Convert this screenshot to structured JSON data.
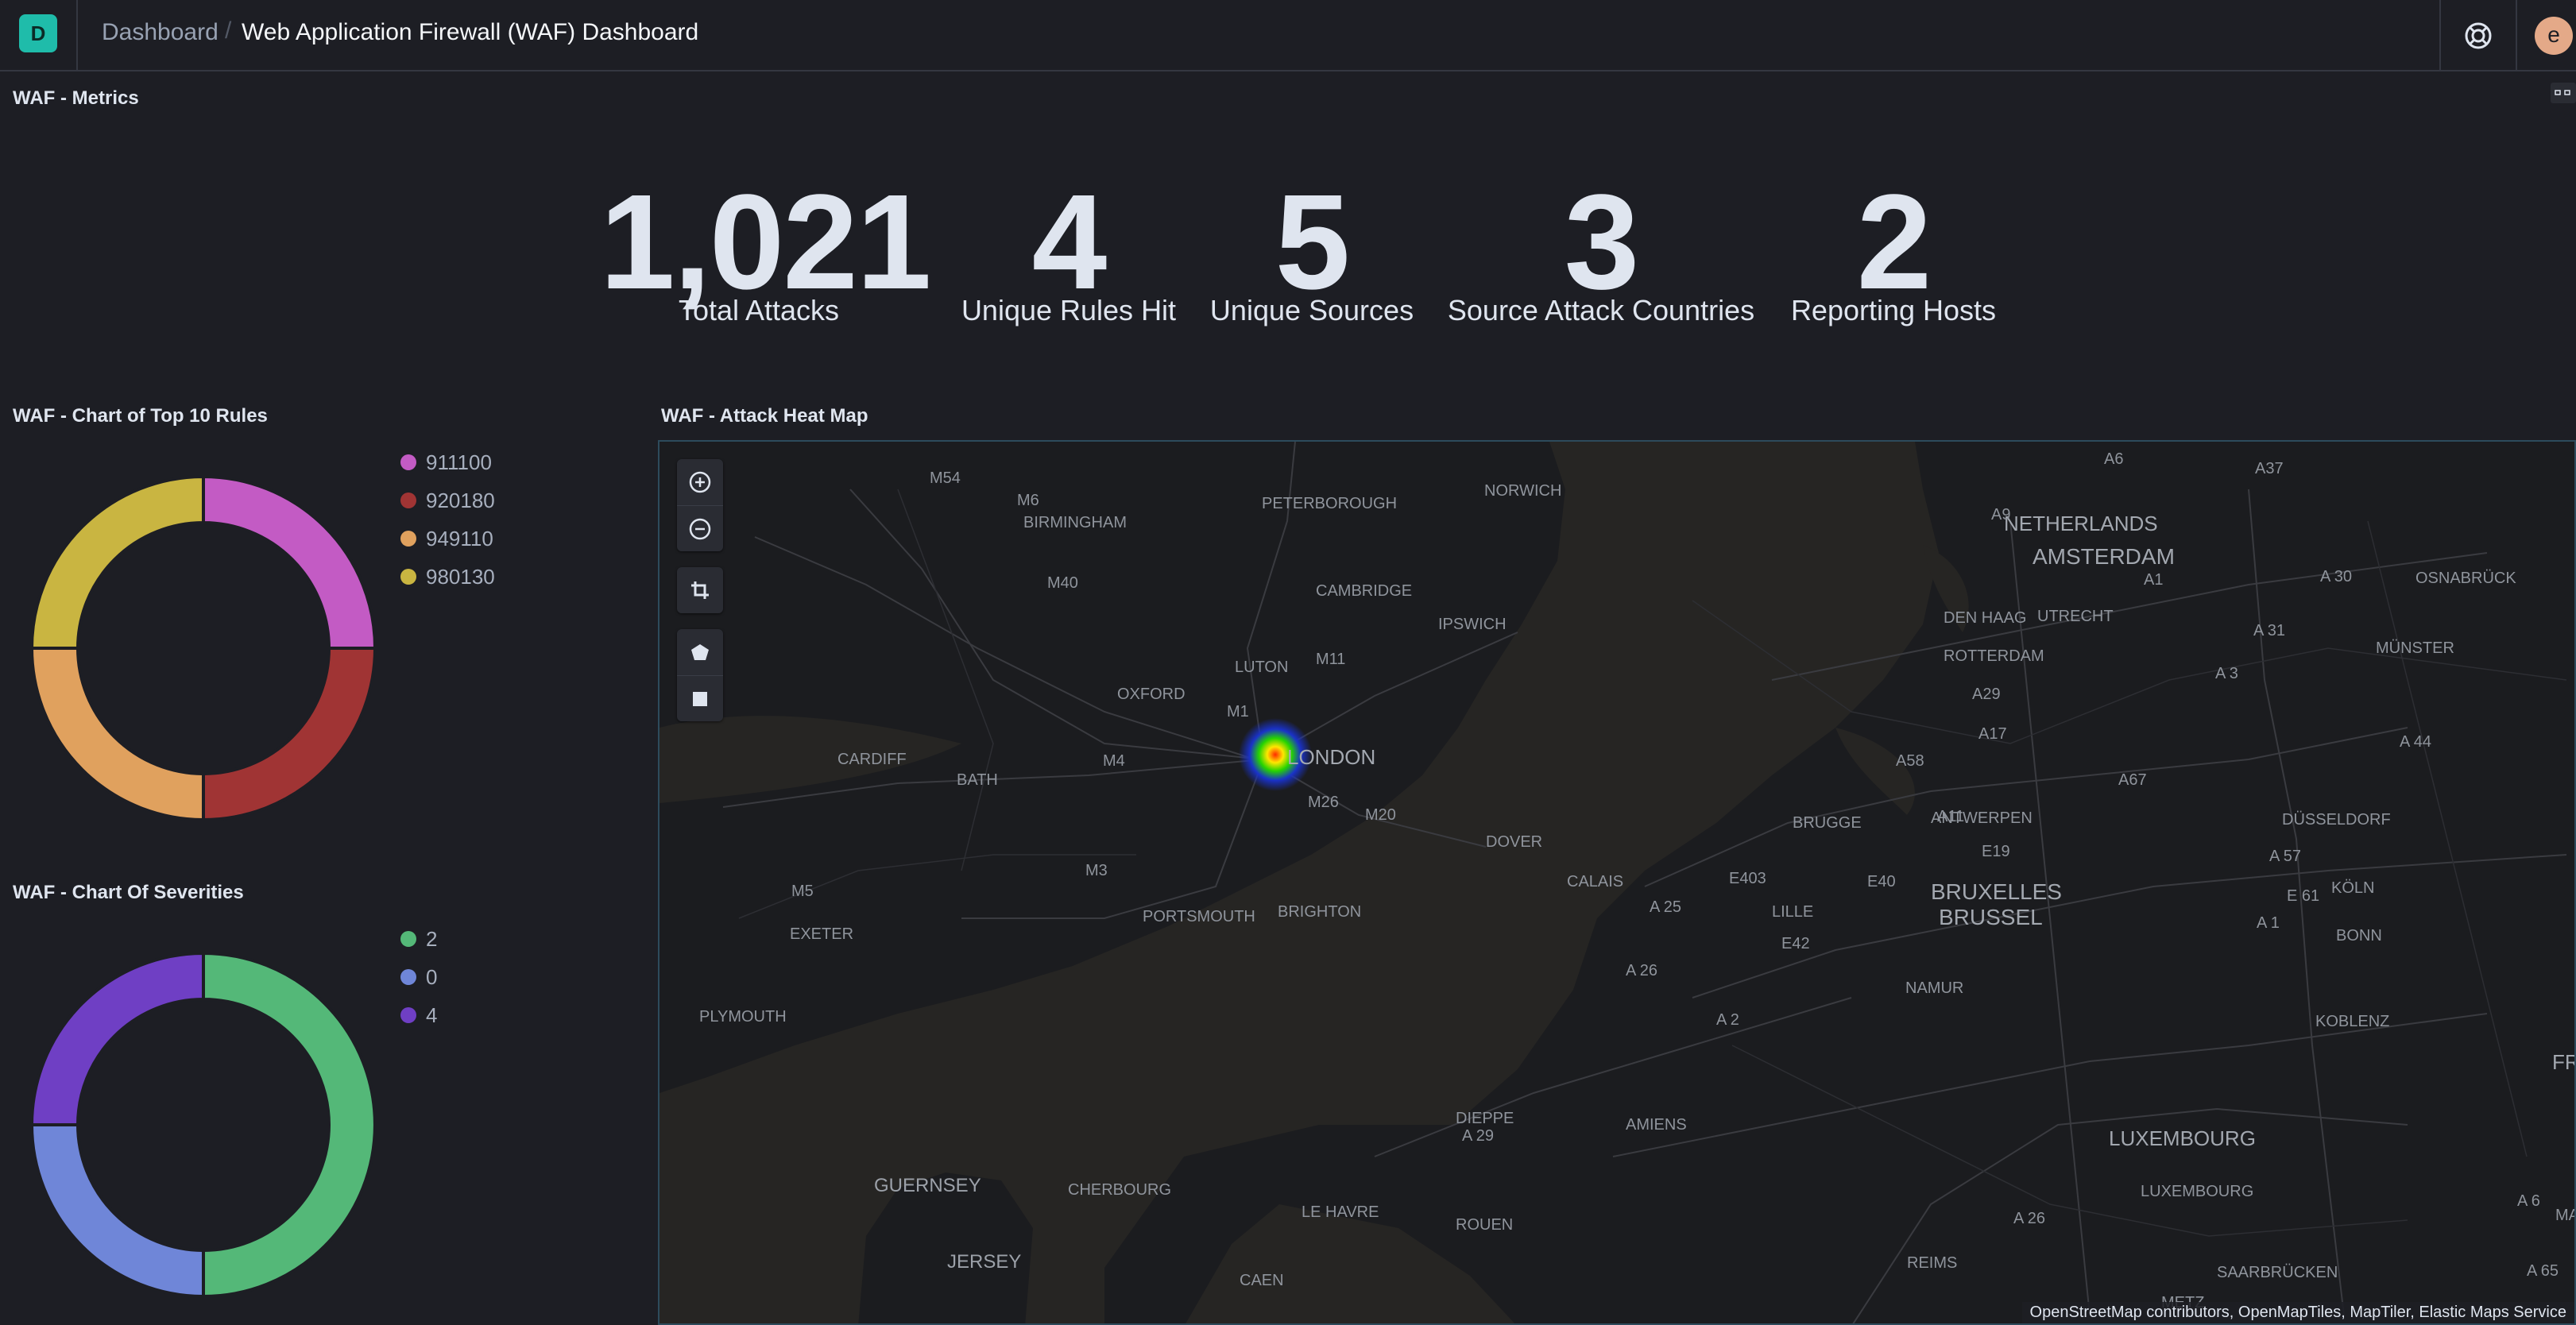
{
  "header": {
    "logo_letter": "D",
    "breadcrumb_root": "Dashboard",
    "breadcrumb_current": "Web Application Firewall (WAF) Dashboard",
    "avatar_letter": "e",
    "help_icon": "help-lifebuoy-icon"
  },
  "metrics_panel": {
    "title": "WAF - Metrics",
    "items": [
      {
        "value": "1,021",
        "label": "Total Attacks"
      },
      {
        "value": "4",
        "label": "Unique Rules Hit"
      },
      {
        "value": "5",
        "label": "Unique Sources"
      },
      {
        "value": "3",
        "label": "Source Attack Countries"
      },
      {
        "value": "2",
        "label": "Reporting Hosts"
      }
    ]
  },
  "rules_panel": {
    "title": "WAF - Chart of Top 10 Rules",
    "legend": [
      {
        "label": "911100",
        "color": "#c35bc4"
      },
      {
        "label": "920180",
        "color": "#a03434"
      },
      {
        "label": "949110",
        "color": "#e0a15e"
      },
      {
        "label": "980130",
        "color": "#c9b541"
      }
    ]
  },
  "severity_panel": {
    "title": "WAF - Chart Of Severities",
    "legend": [
      {
        "label": "2",
        "color": "#54b878"
      },
      {
        "label": "0",
        "color": "#6f86d8"
      },
      {
        "label": "4",
        "color": "#6f3fc4"
      }
    ]
  },
  "chart_data": [
    {
      "type": "pie",
      "title": "WAF - Chart of Top 10 Rules",
      "donut": true,
      "categories": [
        "911100",
        "920180",
        "949110",
        "980130"
      ],
      "values": [
        25,
        25,
        25,
        25
      ],
      "colors": [
        "#c35bc4",
        "#a03434",
        "#e0a15e",
        "#c9b541"
      ],
      "legend": "right"
    },
    {
      "type": "pie",
      "title": "WAF - Chart Of Severities",
      "donut": true,
      "categories": [
        "2",
        "0",
        "4"
      ],
      "values": [
        50,
        25,
        25
      ],
      "colors": [
        "#54b878",
        "#6f86d8",
        "#6f3fc4"
      ],
      "legend": "right"
    }
  ],
  "map_panel": {
    "title": "WAF - Attack Heat Map",
    "attribution": "OpenStreetMap contributors, OpenMapTiles, MapTiler, Elastic Maps Service",
    "controls": [
      "zoom-in-icon",
      "zoom-out-icon",
      "fit-bounds-icon",
      "draw-polygon-icon",
      "draw-bounds-icon"
    ],
    "labels": [
      "M54",
      "M6",
      "BIRMINGHAM",
      "PETERBOROUGH",
      "NORWICH",
      "M40",
      "CAMBRIDGE",
      "IPSWICH",
      "LUTON",
      "M11",
      "M1",
      "OXFORD",
      "LONDON",
      "CARDIFF",
      "M4",
      "BATH",
      "M26",
      "M20",
      "DOVER",
      "M3",
      "M5",
      "PORTSMOUTH",
      "BRIGHTON",
      "EXETER",
      "PLYMOUTH",
      "CALAIS",
      "GUERNSEY",
      "JERSEY",
      "CHERBOURG",
      "LE HAVRE",
      "ROUEN",
      "CAEN",
      "DIEPPE",
      "AMIENS",
      "NETHERLANDS",
      "AMSTERDAM",
      "DEN HAAG",
      "UTRECHT",
      "ROTTERDAM",
      "OSNABRÜCK",
      "MÜNSTER",
      "BRUGGE",
      "ANTWERPEN",
      "DÜSSELDORF",
      "KÖLN",
      "BONN",
      "BRUXELLES",
      "BRUSSEL",
      "LILLE",
      "NAMUR",
      "KOBLENZ",
      "LUXEMBOURG",
      "REIMS",
      "METZ",
      "SAARBRÜCKEN",
      "A6",
      "A37",
      "A9",
      "A1",
      "A 30",
      "A 31",
      "A29",
      "A17",
      "A58",
      "A11",
      "E19",
      "A 57",
      "A67",
      "E40",
      "E403",
      "A 25",
      "E42",
      "A 2",
      "A 26",
      "A 29",
      "A 44",
      "E 61",
      "A 6",
      "A 65",
      "MANN",
      "FR"
    ]
  }
}
